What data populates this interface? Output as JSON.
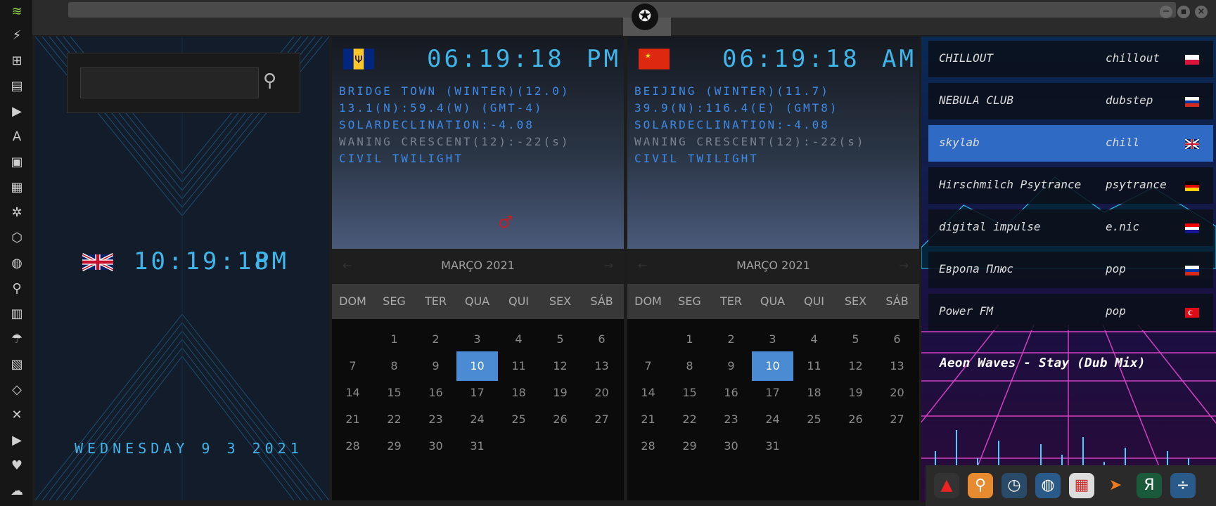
{
  "sidebar": {
    "icons": [
      "wifi-icon",
      "bolt-icon",
      "windows-icon",
      "archive-icon",
      "play-icon",
      "translate-icon",
      "image-icon",
      "news-icon",
      "aperture-icon",
      "hexagon-icon",
      "globe-icon",
      "search-icon",
      "map-icon",
      "umbrella-icon",
      "contacts-icon",
      "code-icon",
      "expand-icon",
      "youtube-icon",
      "heart-icon",
      "cloud-icon"
    ]
  },
  "local_clock": {
    "time": "10:19:18",
    "ampm": "PM",
    "date": "WEDNESDAY 9 3 2021"
  },
  "cities": [
    {
      "time": "06:19:18",
      "ampm": "PM",
      "line1": "BRIDGE TOWN (WINTER)(12.0)",
      "line2": "13.1(N):59.4(W) (GMT-4)",
      "line3": "SOLARDECLINATION:-4.08",
      "line4": "WANING CRESCENT(12):-22(s)",
      "line5": "CIVIL TWILIGHT",
      "month": "MARÇO 2021"
    },
    {
      "time": "06:19:18",
      "ampm": "AM",
      "line1": "BEIJING (WINTER)(11.7)",
      "line2": "39.9(N):116.4(E) (GMT8)",
      "line3": "SOLARDECLINATION:-4.08",
      "line4": "WANING CRESCENT(12):-22(s)",
      "line5": "CIVIL TWILIGHT",
      "month": "MARÇO 2021"
    }
  ],
  "weekdays": [
    "DOM",
    "SEG",
    "TER",
    "QUA",
    "QUI",
    "SEX",
    "SÁB"
  ],
  "calendar_days": [
    "1",
    "2",
    "3",
    "4",
    "5",
    "6",
    "7",
    "8",
    "9",
    "10",
    "11",
    "12",
    "13",
    "14",
    "15",
    "16",
    "17",
    "18",
    "19",
    "20",
    "21",
    "22",
    "23",
    "24",
    "25",
    "26",
    "27",
    "28",
    "29",
    "30",
    "31"
  ],
  "selected_day": "10",
  "stations": [
    {
      "name": "CHILLOUT",
      "genre": "chillout"
    },
    {
      "name": "NEBULA CLUB",
      "genre": "dubstep"
    },
    {
      "name": "skylab",
      "genre": "chill"
    },
    {
      "name": "Hirschmilch Psytrance",
      "genre": "psytrance"
    },
    {
      "name": "digital impulse",
      "genre": "e.nic"
    },
    {
      "name": "Европа Плюс",
      "genre": "pop"
    },
    {
      "name": "Power FM",
      "genre": "pop"
    }
  ],
  "now_playing": "Aeon Waves - Stay (Dub Mix)",
  "dock": [
    "adobe-icon",
    "search-app-icon",
    "clock-app-icon",
    "browser-icon",
    "calendar-icon",
    "arrow-app-icon",
    "yandex-icon",
    "calculator-icon"
  ]
}
